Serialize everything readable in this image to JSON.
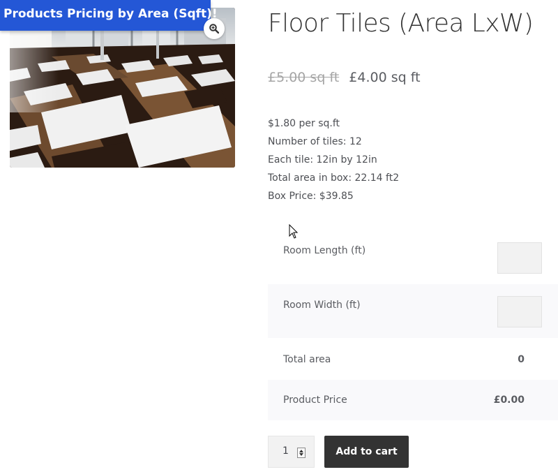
{
  "banner": {
    "text": "Products Pricing by Area (Sqft)!"
  },
  "product": {
    "title": "Floor Tiles (Area LxW)",
    "price_old": "£5.00 sq ft",
    "price_new": "£4.00 sq ft",
    "description": [
      "$1.80 per sq.ft",
      "Number of tiles: 12",
      "Each tile: 12in by 12in",
      "Total area in box: 22.14 ft2",
      "Box Price: $39.85"
    ],
    "image_icon": "zoom-icon"
  },
  "calculator": {
    "length_label": "Room Length (ft)",
    "length_value": "",
    "width_label": "Room Width (ft)",
    "width_value": "",
    "total_area_label": "Total area",
    "total_area_value": "0",
    "product_price_label": "Product Price",
    "product_price_value": "£0.00"
  },
  "cart": {
    "quantity": "1",
    "add_label": "Add to cart"
  },
  "colors": {
    "banner": "#2457d6",
    "button": "#333333",
    "row_alt": "#f9f9fb"
  }
}
